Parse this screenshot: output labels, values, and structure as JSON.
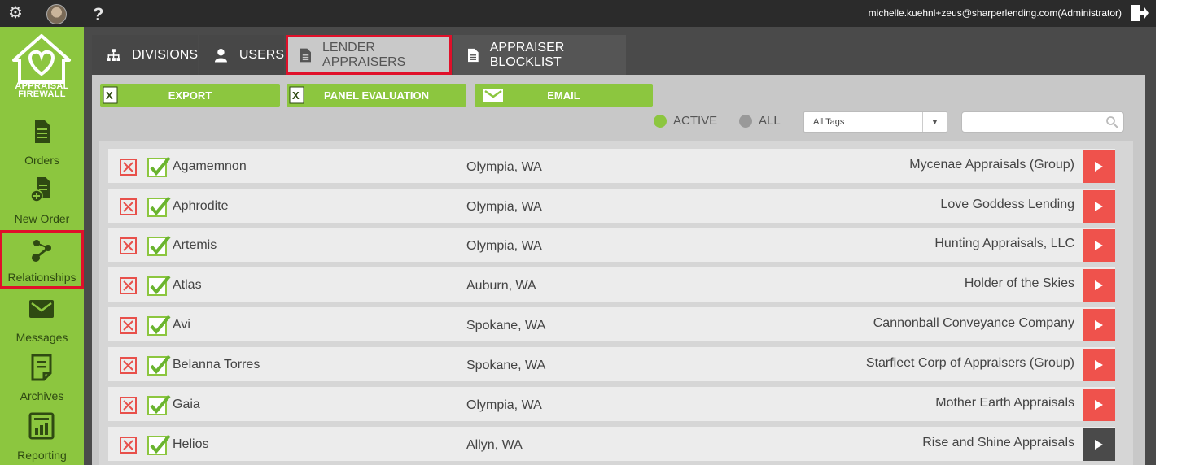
{
  "topbar": {
    "user_email": "michelle.kuehnl+zeus@sharperlending.com(Administrator)",
    "help_glyph": "?"
  },
  "sidebar": {
    "logo_text_line1": "APPRAISAL",
    "logo_text_line2": "FIREWALL",
    "items": [
      {
        "label": "Orders",
        "icon": "orders-icon"
      },
      {
        "label": "New Order",
        "icon": "new-order-icon"
      },
      {
        "label": "Relationships",
        "icon": "relationships-icon"
      },
      {
        "label": "Messages",
        "icon": "envelope-icon"
      },
      {
        "label": "Archives",
        "icon": "archives-icon"
      },
      {
        "label": "Reporting",
        "icon": "reporting-icon"
      }
    ]
  },
  "tabs": [
    {
      "label": "DIVISIONS"
    },
    {
      "label": "USERS"
    },
    {
      "label": "LENDER APPRAISERS"
    },
    {
      "label": "APPRAISER BLOCKLIST"
    }
  ],
  "toolbar": {
    "export_label": "EXPORT",
    "panel_eval_label": "PANEL EVALUATION",
    "email_label": "EMAIL"
  },
  "filters": {
    "active_label": "ACTIVE",
    "all_label": "ALL",
    "tags_value": "All Tags",
    "search_value": ""
  },
  "colors": {
    "brand_green": "#8cc63f",
    "go_red": "#ef524c",
    "highlight_red": "#e0102a"
  },
  "appraisers": [
    {
      "name": "Agamemnon",
      "city": "Olympia, WA",
      "company": "Mycenae Appraisals (Group)"
    },
    {
      "name": "Aphrodite",
      "city": "Olympia, WA",
      "company": "Love Goddess Lending"
    },
    {
      "name": "Artemis",
      "city": "Olympia, WA",
      "company": "Hunting Appraisals, LLC"
    },
    {
      "name": "Atlas",
      "city": "Auburn, WA",
      "company": "Holder of the Skies"
    },
    {
      "name": "Avi",
      "city": "Spokane, WA",
      "company": "Cannonball Conveyance Company"
    },
    {
      "name": "Belanna Torres",
      "city": "Spokane, WA",
      "company": "Starfleet Corp of Appraisers (Group)"
    },
    {
      "name": "Gaia",
      "city": "Olympia, WA",
      "company": "Mother Earth Appraisals"
    },
    {
      "name": "Helios",
      "city": "Allyn, WA",
      "company": "Rise and Shine Appraisals"
    }
  ]
}
